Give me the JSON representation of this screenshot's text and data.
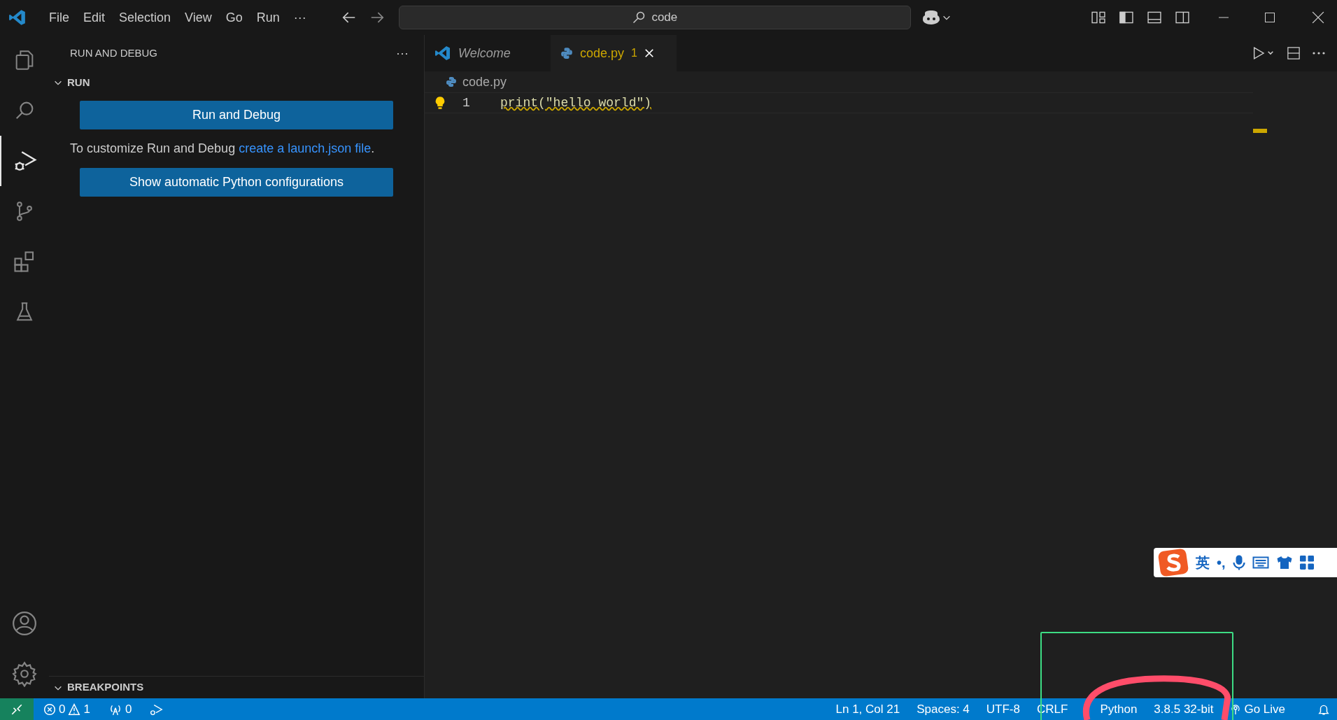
{
  "menu": [
    "File",
    "Edit",
    "Selection",
    "View",
    "Go",
    "Run",
    "···"
  ],
  "search": {
    "value": "code"
  },
  "sidebar": {
    "title": "RUN AND DEBUG",
    "more": "···",
    "section": {
      "label": "RUN",
      "expanded": true
    },
    "run_button": "Run and Debug",
    "hint": "To customize Run and Debug ",
    "hint_link": "create a launch.json file",
    "hint_end": ".",
    "config_button": "Show automatic Python configurations",
    "breakpoints": {
      "label": "BREAKPOINTS",
      "expanded": true
    }
  },
  "activity": [
    {
      "kind": "files",
      "selected": false
    },
    {
      "kind": "search",
      "selected": false
    },
    {
      "kind": "debug",
      "selected": true
    },
    {
      "kind": "git",
      "selected": false
    },
    {
      "kind": "extensions",
      "selected": false
    },
    {
      "kind": "testing",
      "selected": false
    }
  ],
  "tabs": [
    {
      "label": "Welcome",
      "kind": "welcome",
      "selected": false
    },
    {
      "label": "code.py",
      "kind": "python",
      "selected": true,
      "problems": "1"
    }
  ],
  "breadcrumb": "code.py",
  "code": [
    {
      "number": "1",
      "text": "print(\"hello world\")"
    }
  ],
  "ime": {
    "language": "英",
    "punctuation": "•,"
  },
  "status_bar": {
    "errors": "0",
    "warnings": "1",
    "ports": "0",
    "right": [
      "Ln 1, Col 21",
      "Spaces: 4",
      "UTF-8",
      "CRLF",
      "Python",
      "3.8.5 32-bit",
      "Go Live"
    ]
  }
}
